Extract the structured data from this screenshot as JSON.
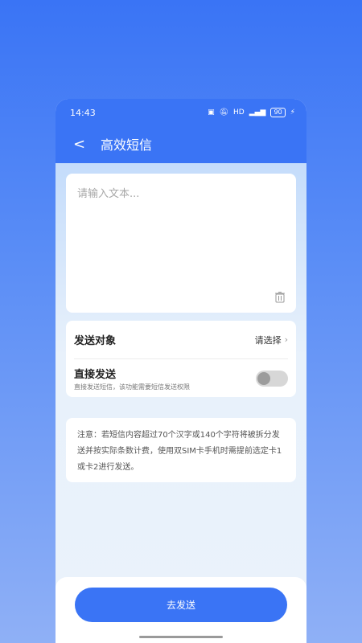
{
  "status": {
    "time": "14:43",
    "battery": "90",
    "icons": [
      "nfc-icon",
      "mute-icon",
      "hd-icon",
      "signal-icon",
      "battery-icon",
      "charging-icon"
    ]
  },
  "header": {
    "title": "高效短信",
    "back_icon": "back-icon"
  },
  "editor": {
    "placeholder": "请输入文本..."
  },
  "options": {
    "recipient_label": "发送对象",
    "recipient_value": "请选择",
    "direct_label": "直接发送",
    "direct_desc": "直接发送短信，该功能需要短信发送权限",
    "direct_enabled": false
  },
  "note": {
    "text": "注意：若短信内容超过70个汉字或140个字符将被拆分发送并按实际条数计费，使用双SIM卡手机时需提前选定卡1或卡2进行发送。"
  },
  "footer": {
    "submit_label": "去发送"
  },
  "colors": {
    "primary": "#3a74f5"
  }
}
